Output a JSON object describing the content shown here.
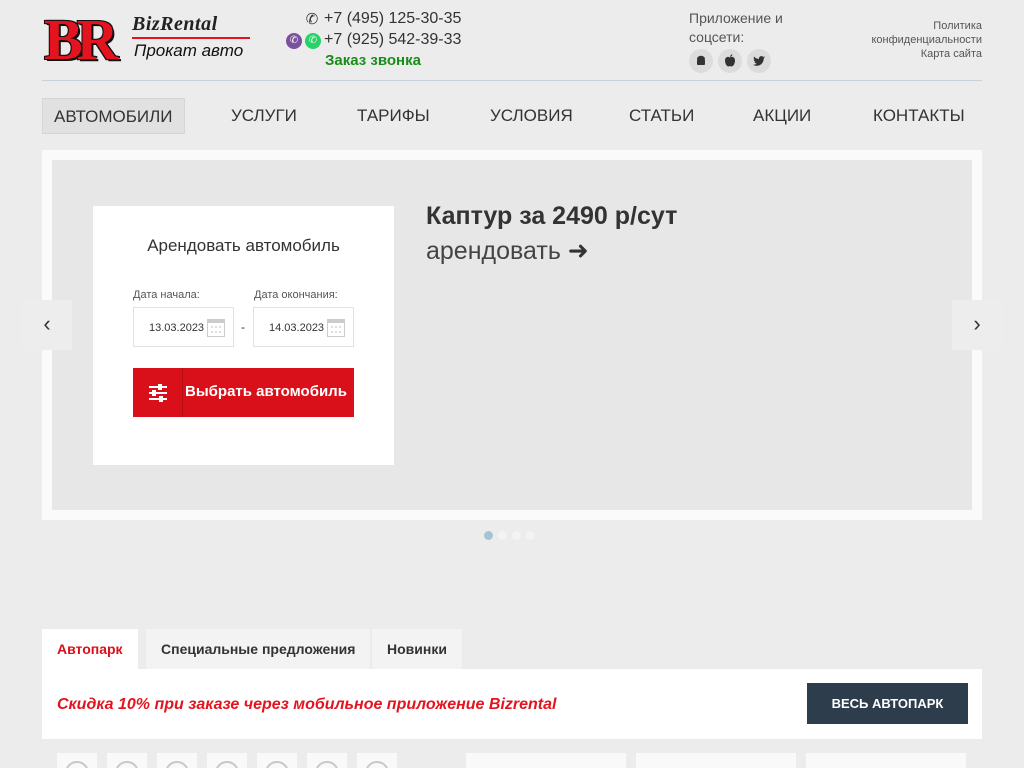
{
  "header": {
    "logo": {
      "mark": "BR",
      "name": "BizRental",
      "tagline": "Прокат авто"
    },
    "phones": [
      {
        "number": "+7 (495) 125-30-35",
        "icons": [
          "phone-icon"
        ]
      },
      {
        "number": "+7 (925) 542-39-33",
        "icons": [
          "viber-icon",
          "whatsapp-icon"
        ]
      }
    ],
    "callback_label": "Заказ звонка",
    "apps": {
      "title": "Приложение и соцсети:",
      "icons": [
        "android-icon",
        "apple-icon",
        "twitter-icon"
      ]
    },
    "links": {
      "privacy": "Политика конфиденциальности",
      "sitemap": "Карта сайта"
    }
  },
  "nav": {
    "items": [
      {
        "label": "Автомобили",
        "active": true
      },
      {
        "label": "Услуги",
        "active": false
      },
      {
        "label": "Тарифы",
        "active": false
      },
      {
        "label": "Условия",
        "active": false
      },
      {
        "label": "Статьи",
        "active": false
      },
      {
        "label": "Акции",
        "active": false
      },
      {
        "label": "Контакты",
        "active": false
      }
    ]
  },
  "slider": {
    "title": "Каптур за 2490 р/сут",
    "link_label": "арендовать",
    "prev_glyph": "‹",
    "next_glyph": "›",
    "dots_count": 4,
    "active_dot": 0
  },
  "booking": {
    "title": "Арендовать автомобиль",
    "start_label": "Дата начала:",
    "start_value": "13.03.2023",
    "end_label": "Дата окончания:",
    "end_value": "14.03.2023",
    "separator": "-",
    "submit_label": "Выбрать автомобиль"
  },
  "tabs": {
    "items": [
      {
        "label": "Автопарк",
        "active": true
      },
      {
        "label": "Специальные предложения",
        "active": false
      },
      {
        "label": "Новинки",
        "active": false
      }
    ]
  },
  "promo": {
    "text": "Скидка 10% при заказе через мобильное приложение Bizrental",
    "button_label": "Весь автопарк"
  },
  "colors": {
    "brand_red": "#d9101a",
    "dark_button": "#2e3d4b",
    "callback_green": "#1a8c1a"
  }
}
